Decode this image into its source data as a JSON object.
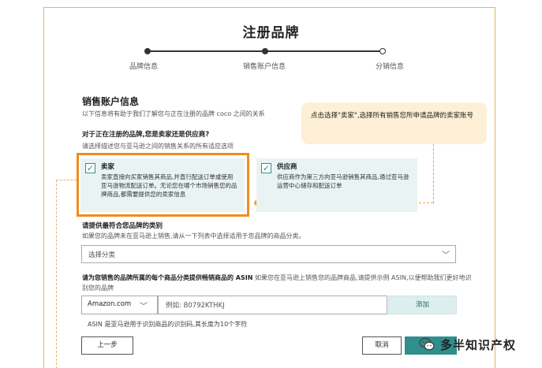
{
  "page": {
    "title": "注册品牌"
  },
  "steps": [
    {
      "label": "品牌信息",
      "state": "done"
    },
    {
      "label": "销售账户信息",
      "state": "done"
    },
    {
      "label": "分销信息",
      "state": "current"
    }
  ],
  "section": {
    "title": "销售账户信息",
    "subtitle": "以下信息将有助于我们了解您与正在注册的品牌 coco 之间的关系"
  },
  "question1": {
    "title": "对于正在注册的品牌,您是卖家还是供应商?",
    "hint": "请选择描述您与亚马逊之间的销售关系的所有适应选项"
  },
  "options": [
    {
      "title": "卖家",
      "desc": "卖家直接向买家销售其商品,并直行配送订单或使用亚马逊物流配送订单。无论您在哪个市场销售您的品牌商品,都需要提供您的卖家信息",
      "checked": true,
      "check_mark": "✓"
    },
    {
      "title": "供应商",
      "desc": "供应商作为第三方向亚马逊销售其商品,通过亚马逊运营中心储存和配送订单",
      "checked": true,
      "check_mark": "✓"
    }
  ],
  "callout": {
    "text": "点击选择\"卖家\",选择所有销售您所申请品牌的卖家账号"
  },
  "question2": {
    "title": "请提供最符合您品牌的类别",
    "hint": "如果您的品牌未在亚马逊上销售,请从一下列表中选择适用于您品牌的商品分类。"
  },
  "category_select": {
    "value": "选择分类",
    "icon": "chevron-down-icon",
    "chevron": "﹀"
  },
  "question3": {
    "title": "请为您销售的品牌所属的每个商品分类提供畅销商品的 ASIN",
    "hint": "如果您在亚马逊上销售您的品牌商品,请提供示例 ASIN,以便帮助我们更好地识别您的品牌"
  },
  "asin_row": {
    "marketplace": "Amazon.com",
    "marketplace_chevron": "﹀",
    "asin_placeholder": "例如: B0792KTHKJ",
    "add_label": "添加",
    "note": "ASIN 是亚马逊用于识别商品的识别码,其长度为10个字符"
  },
  "footer": {
    "prev_label": "上一步",
    "cancel_label": "取消"
  },
  "watermark": {
    "text": "多半知识产权"
  },
  "colors": {
    "accent": "#2f8f8c",
    "highlight": "#ef8c1e",
    "callout_bg": "#fdf0d6",
    "card_bg": "#e8f3f2"
  }
}
